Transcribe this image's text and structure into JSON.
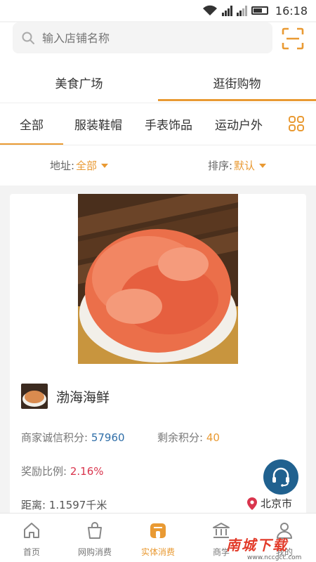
{
  "status_bar": {
    "time": "16:18"
  },
  "search": {
    "placeholder": "输入店铺名称"
  },
  "main_tabs": [
    {
      "label": "美食广场",
      "active": false
    },
    {
      "label": "逛街购物",
      "active": true
    }
  ],
  "category_tabs": [
    {
      "label": "全部",
      "active": true
    },
    {
      "label": "服装鞋帽",
      "active": false
    },
    {
      "label": "手表饰品",
      "active": false
    },
    {
      "label": "运动户外",
      "active": false
    }
  ],
  "filters": {
    "address_label": "地址:",
    "address_value": "全部",
    "sort_label": "排序:",
    "sort_value": "默认"
  },
  "store": {
    "name": "渤海海鲜",
    "credit_label": "商家诚信积分:",
    "credit_value": "57960",
    "remaining_label": "剩余积分:",
    "remaining_value": "40",
    "reward_label": "奖励比例:",
    "reward_value": "2.16%",
    "distance_label": "距离:",
    "distance_value": "1.1597千米",
    "city": "北京市"
  },
  "bottom_nav": [
    {
      "label": "首页",
      "icon": "home-icon",
      "active": false
    },
    {
      "label": "网购消费",
      "icon": "shopping-bag-icon",
      "active": false
    },
    {
      "label": "实体消费",
      "icon": "store-icon",
      "active": true
    },
    {
      "label": "商学",
      "icon": "bank-icon",
      "active": false
    },
    {
      "label": "我的",
      "icon": "user-icon",
      "active": false
    }
  ],
  "watermark": {
    "title": "南城下载",
    "url": "www.nccgcc.com"
  },
  "colors": {
    "accent": "#e99a33",
    "blue": "#2f6ea8",
    "red": "#d9354d",
    "service": "#20618f"
  }
}
